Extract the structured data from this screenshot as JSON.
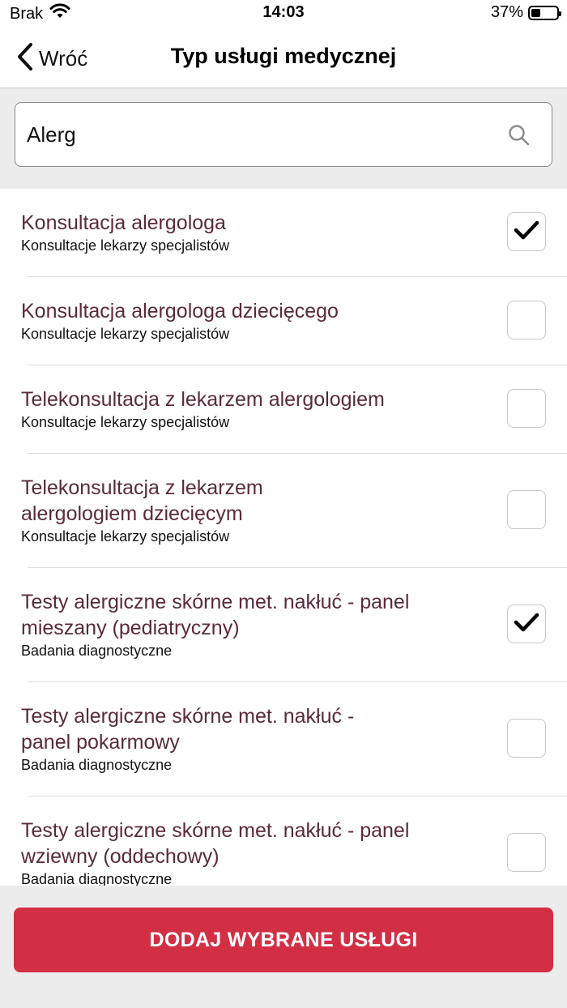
{
  "status_bar": {
    "carrier": "Brak",
    "time": "14:03",
    "battery_percent": "37%",
    "battery_level": 0.37,
    "wifi_icon": "wifi-icon"
  },
  "nav": {
    "back_label": "Wróć",
    "title": "Typ usługi medycznej"
  },
  "search": {
    "value": "Alerg",
    "placeholder": ""
  },
  "items": [
    {
      "title": "Konsultacja alergologa",
      "subtitle": "Konsultacje lekarzy specjalistów",
      "checked": true
    },
    {
      "title": "Konsultacja alergologa dziecięcego",
      "subtitle": "Konsultacje lekarzy specjalistów",
      "checked": false
    },
    {
      "title": "Telekonsultacja z lekarzem alergologiem",
      "subtitle": "Konsultacje lekarzy specjalistów",
      "checked": false
    },
    {
      "title": "Telekonsultacja z lekarzem alergologiem dziecięcym",
      "subtitle": "Konsultacje lekarzy specjalistów",
      "checked": false
    },
    {
      "title": "Testy alergiczne skórne met. nakłuć - panel mieszany (pediatryczny)",
      "subtitle": "Badania diagnostyczne",
      "checked": true
    },
    {
      "title": "Testy alergiczne skórne met. nakłuć - panel pokarmowy",
      "subtitle": "Badania diagnostyczne",
      "checked": false
    },
    {
      "title": "Testy alergiczne skórne met. nakłuć - panel wziewny (oddechowy)",
      "subtitle": "Badania diagnostyczne",
      "checked": false
    }
  ],
  "actions": {
    "add_selected_label": "DODAJ WYBRANE USŁUGI"
  },
  "colors": {
    "accent": "#d22f45",
    "item_title": "#5a2a3c",
    "background_gray": "#ececec"
  }
}
